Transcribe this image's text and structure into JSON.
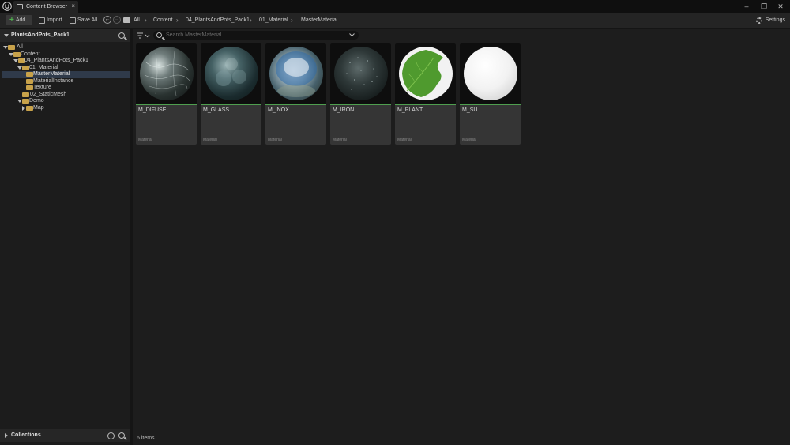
{
  "window": {
    "tab_title": "Content Browser",
    "tab_close": "×",
    "controls": {
      "minimize": "–",
      "restore": "❐",
      "close": "✕"
    }
  },
  "toolbar": {
    "add_label": "Add",
    "add_glyph": "+",
    "import_label": "Import",
    "save_all_label": "Save All",
    "settings_label": "Settings",
    "history_back": "←",
    "history_forward": "→"
  },
  "breadcrumb": {
    "items": [
      "All",
      "Content",
      "04_PlantsAndPots_Pack1",
      "01_Material",
      "MasterMaterial"
    ],
    "separator": "›"
  },
  "sidebar": {
    "title": "PlantsAndPots_Pack1",
    "tree": [
      {
        "label": "All"
      },
      {
        "label": "Content"
      },
      {
        "label": "04_PlantsAndPots_Pack1"
      },
      {
        "label": "01_Material"
      },
      {
        "label": "MasterMaterial"
      },
      {
        "label": "MaterialInstance"
      },
      {
        "label": "Texture"
      },
      {
        "label": "02_StaticMesh"
      },
      {
        "label": "Demo"
      },
      {
        "label": "Map"
      }
    ],
    "collections_label": "Collections",
    "collections_add": "+"
  },
  "search": {
    "placeholder": "Search MasterMaterial"
  },
  "assets": [
    {
      "name": "M_DIFUSE",
      "type": "Material"
    },
    {
      "name": "M_GLASS",
      "type": "Material"
    },
    {
      "name": "M_INOX",
      "type": "Material"
    },
    {
      "name": "M_IRON",
      "type": "Material"
    },
    {
      "name": "M_PLANT",
      "type": "Material"
    },
    {
      "name": "M_SU",
      "type": "Material"
    }
  ],
  "status": {
    "item_count": "6 items"
  },
  "colors": {
    "accent_green": "#4f9f4f",
    "selection": "#2f3a4a",
    "folder": "#c8a24a"
  }
}
